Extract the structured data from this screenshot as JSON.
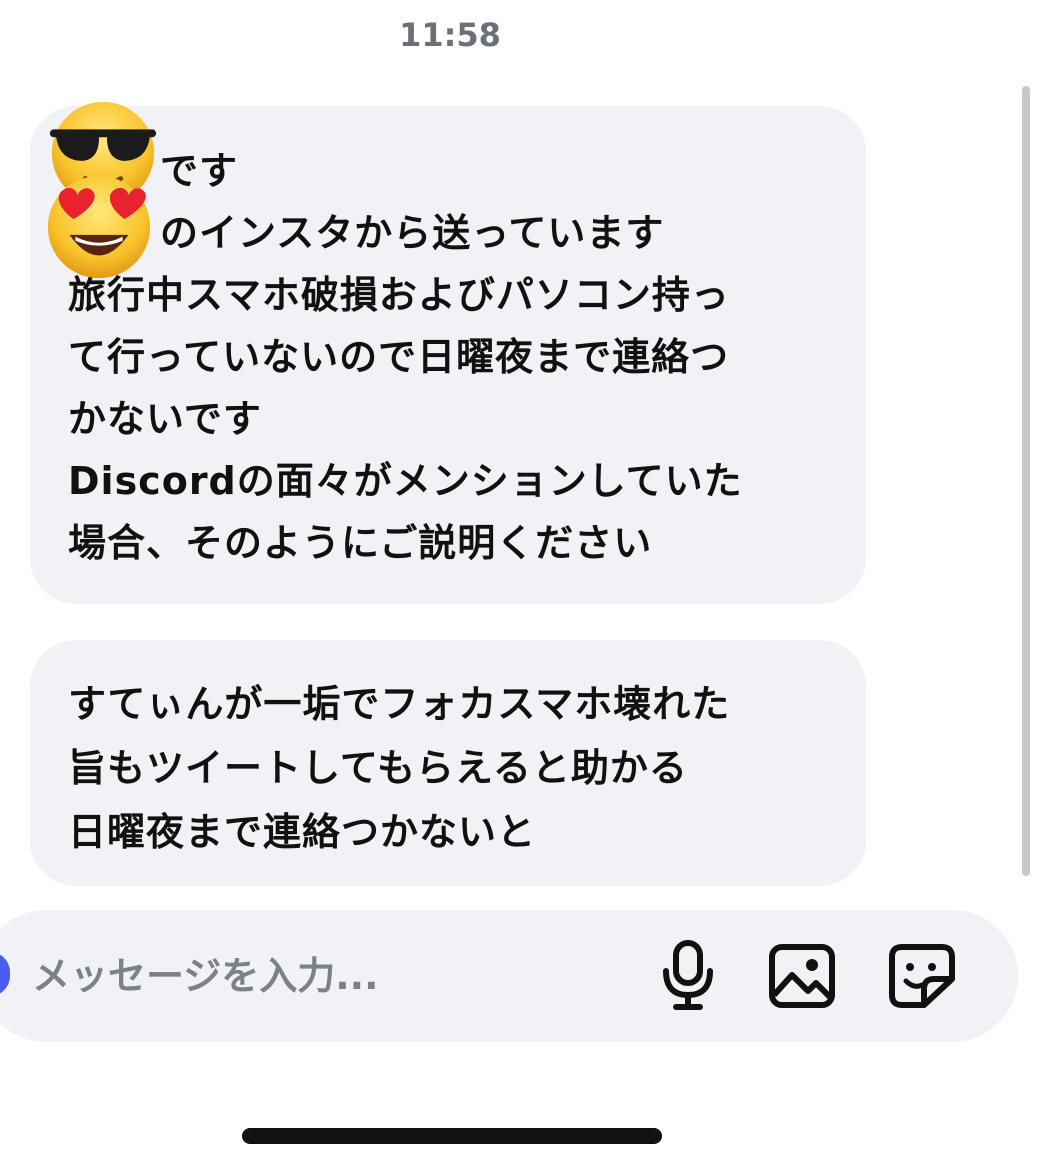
{
  "status": {
    "time": "11:58"
  },
  "messages": [
    {
      "lines": [
        "です",
        "のインスタから送っています",
        "旅行中スマホ破損およびパソコン持っ",
        "て行っていないので日曜夜まで連絡つ",
        "かないです",
        "Discordの面々がメンションしていた",
        "場合、そのようにご説明ください"
      ]
    },
    {
      "lines": [
        "すてぃんが一垢でフォカスマホ壊れた",
        "旨もツイートしてもらえると助かる",
        "日曜夜まで連絡つかないと"
      ]
    }
  ],
  "emoji_stickers": [
    "smiling-face-with-sunglasses",
    "smiling-face-with-heart-eyes"
  ],
  "composer": {
    "placeholder": "メッセージを入力...",
    "icons": [
      "microphone-icon",
      "image-icon",
      "sticker-icon"
    ]
  },
  "colors": {
    "bubble_bg": "#f1f2f5",
    "text": "#111111",
    "muted": "#6b6f76",
    "avatar_accent": "#4a5cf0"
  }
}
